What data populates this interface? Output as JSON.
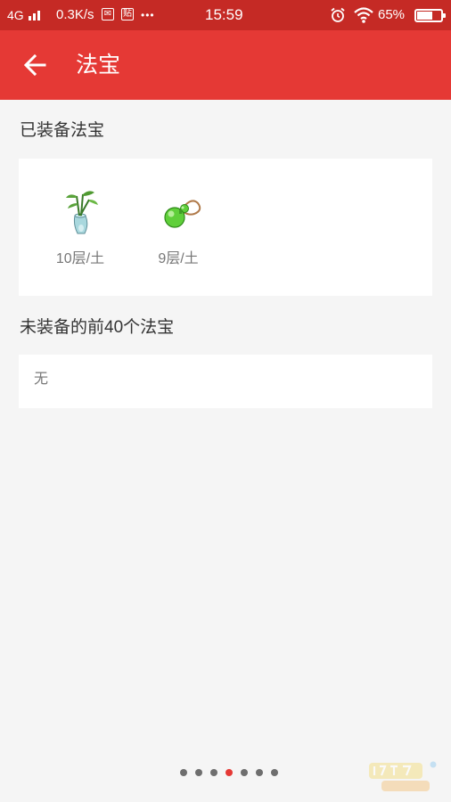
{
  "status_bar": {
    "network": "4G",
    "speed": "0.3K/s",
    "time": "15:59",
    "battery_percent": "65%",
    "battery_level": 0.65,
    "notification_icons": [
      "mail-icon",
      "sticker-icon"
    ],
    "more": "•••"
  },
  "header": {
    "back_icon": "arrow-left-icon",
    "title": "法宝"
  },
  "equipped": {
    "title": "已装备法宝",
    "items": [
      {
        "icon": "bamboo-vase-icon",
        "label": "10层/土"
      },
      {
        "icon": "green-gourd-icon",
        "label": "9层/土"
      }
    ]
  },
  "unequipped": {
    "title": "未装备的前40个法宝",
    "empty_text": "无"
  },
  "pager": {
    "count": 7,
    "active_index": 3,
    "active_color": "#e53935",
    "inactive_color": "#6e6e6e"
  },
  "colors": {
    "app_bar": "#e53935",
    "status_bar": "#c52a25",
    "background": "#f5f5f5"
  }
}
